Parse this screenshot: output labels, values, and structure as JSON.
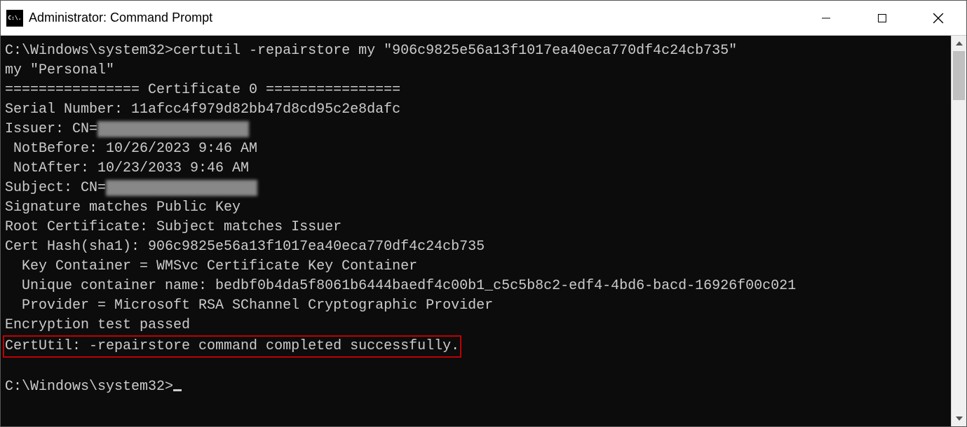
{
  "window": {
    "title": "Administrator: Command Prompt",
    "icon_label": "C:\\."
  },
  "terminal": {
    "lines": {
      "l1": "C:\\Windows\\system32>certutil -repairstore my \"906c9825e56a13f1017ea40eca770df4c24cb735\"",
      "l2": "my \"Personal\"",
      "l3": "================ Certificate 0 ================",
      "l4": "Serial Number: 11afcc4f979d82bb47d8cd95c2e8dafc",
      "l5a": "Issuer: CN=",
      "l5b": "XXbb47dXcd95c1eXdX",
      "l6": " NotBefore: 10/26/2023 9:46 AM",
      "l7": " NotAfter: 10/23/2033 9:46 AM",
      "l8a": "Subject: CN=",
      "l8b": "XXbb47dXcd95c1eXdX",
      "l9": "Signature matches Public Key",
      "l10": "Root Certificate: Subject matches Issuer",
      "l11": "Cert Hash(sha1): 906c9825e56a13f1017ea40eca770df4c24cb735",
      "l12": "  Key Container = WMSvc Certificate Key Container",
      "l13": "  Unique container name: bedbf0b4da5f8061b6444baedf4c00b1_c5c5b8c2-edf4-4bd6-bacd-16926f00c021",
      "l14": "  Provider = Microsoft RSA SChannel Cryptographic Provider",
      "l15": "Encryption test passed",
      "l16": "CertUtil: -repairstore command completed successfully.",
      "l17": "",
      "l18": "C:\\Windows\\system32>"
    }
  }
}
